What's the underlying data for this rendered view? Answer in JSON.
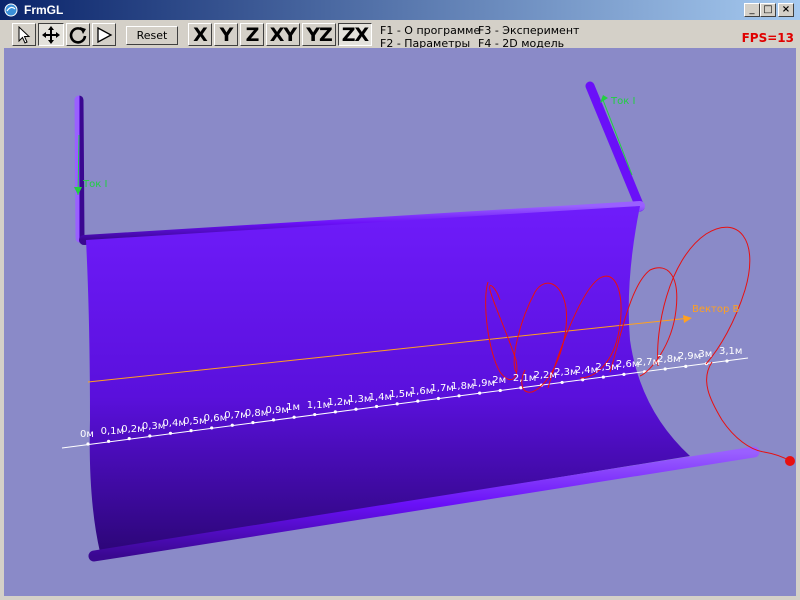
{
  "window": {
    "title": "FrmGL",
    "minimize_label": "_",
    "maximize_label": "□",
    "close_label": "×"
  },
  "toolbar": {
    "tools": [
      "select",
      "move",
      "rotate",
      "play"
    ],
    "reset_label": "Reset",
    "axis_views": [
      "X",
      "Y",
      "Z",
      "XY",
      "YZ",
      "ZX"
    ],
    "active_view": "ZX",
    "help": {
      "f1": "F1 - О программе",
      "f2": "F2 - Параметры",
      "f3": "F3 - Эксперимент",
      "f4": "F4 - 2D модель"
    },
    "fps": "FPS=13"
  },
  "scene": {
    "current_label_1": "Ток I",
    "current_label_2": "Ток I",
    "vector_b_label": "Вектор B",
    "ruler_ticks": [
      "0м",
      "0,1м",
      "0,2м",
      "0,3м",
      "0,4м",
      "0,5м",
      "0,6м",
      "0,7м",
      "0,8м",
      "0,9м",
      "1м",
      "1,1м",
      "1,2м",
      "1,3м",
      "1,4м",
      "1,5м",
      "1,6м",
      "1,7м",
      "1,8м",
      "1,9м",
      "2м",
      "2,1м",
      "2,2м",
      "2,3м",
      "2,4м",
      "2,5м",
      "2,6м",
      "2,7м",
      "2,8м",
      "2,9м",
      "3м",
      "3,1м"
    ],
    "colors": {
      "background": "#8a8ac8",
      "magnet": "#6a10f8",
      "trajectory": "#e81010",
      "vector_b": "#ffa020",
      "current": "#20d040",
      "ruler": "#ffffff"
    }
  }
}
